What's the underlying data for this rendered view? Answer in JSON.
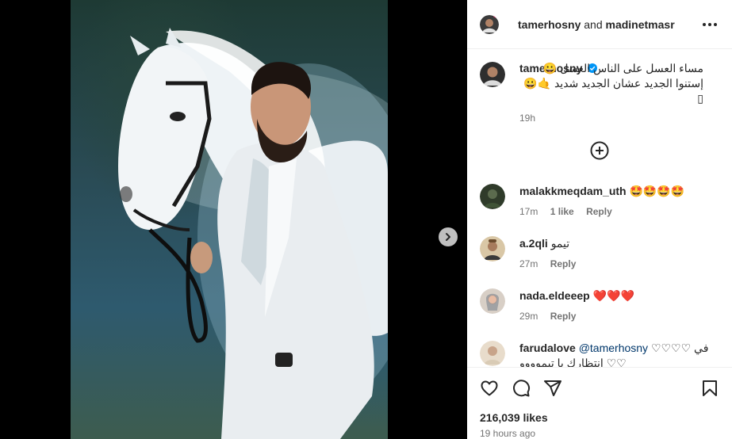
{
  "header": {
    "author": "tamerhosny",
    "joiner": "and",
    "collaborator": "madinetmasr"
  },
  "caption": {
    "username": "tamerhosny",
    "text": "مساء العسل على الناس العسل 😀 إستنوا الجديد عشان الجديد شديد 🤙😀▯",
    "time": "19h"
  },
  "comments": [
    {
      "username": "malakkmeqdam_uth",
      "text": "🤩🤩🤩🤩",
      "time": "17m",
      "likes": "1 like",
      "reply": "Reply"
    },
    {
      "username": "a.2qli",
      "text": "تيمو",
      "time": "27m",
      "reply": "Reply"
    },
    {
      "username": "nada.eldeeep",
      "text": "❤️❤️❤️",
      "time": "29m",
      "reply": "Reply"
    },
    {
      "username": "farudalove",
      "mention": "@tamerhosny",
      "text": "♡♡♡♡ في انتظارك يا تيموووو ♡♡",
      "time": "",
      "reply": ""
    }
  ],
  "post": {
    "likes": "216,039 likes",
    "timestamp": "19 hours ago"
  },
  "icons": {
    "more": "more-horizontal-icon",
    "load_more": "plus-circle-icon",
    "like": "heart-icon",
    "comment": "comment-icon",
    "share": "send-icon",
    "save": "bookmark-icon",
    "next": "chevron-right-icon",
    "verified": "verified-badge-icon"
  },
  "colors": {
    "verified": "#0095f6",
    "meta_text": "#737373",
    "text": "#262626"
  }
}
